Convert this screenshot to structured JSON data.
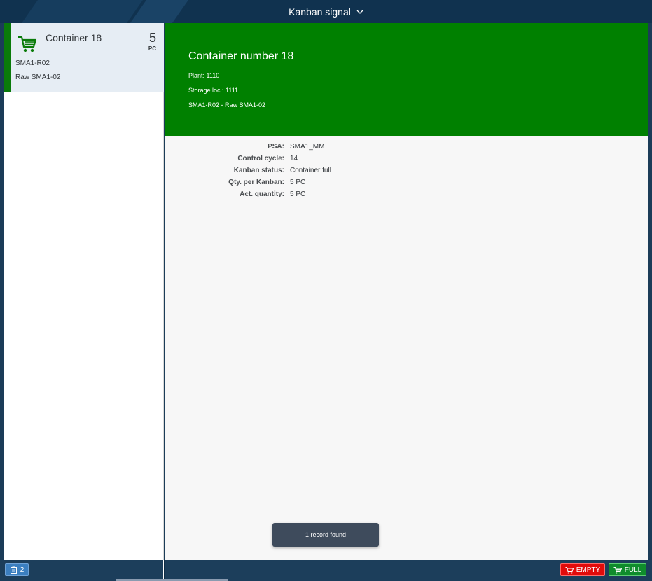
{
  "shell": {
    "title": "Kanban signal"
  },
  "master": {
    "items": [
      {
        "title": "Container 18",
        "number": "5",
        "unit": "PC",
        "attribute1": "SMA1-R02",
        "attribute2": "Raw SMA1-02",
        "status_color": "#0a7b0a"
      }
    ]
  },
  "detail": {
    "header": {
      "title": "Container number 18",
      "plant": "Plant: 1110",
      "storage": "Storage loc.: 1111",
      "description": "SMA1-R02 - Raw SMA1-02",
      "color": "#008000"
    },
    "fields": [
      {
        "label": "PSA:",
        "value": "SMA1_MM"
      },
      {
        "label": "Control cycle:",
        "value": "14"
      },
      {
        "label": "Kanban status:",
        "value": "Container full"
      },
      {
        "label": "Qty. per Kanban:",
        "value": "5 PC"
      },
      {
        "label": "Act. quantity:",
        "value": "5 PC"
      }
    ]
  },
  "toast": {
    "message": "1 record found"
  },
  "footer": {
    "count": "2",
    "empty_label": "EMPTY",
    "full_label": "FULL",
    "empty_color": "#e10b0b",
    "full_color": "#0f8c2c"
  }
}
